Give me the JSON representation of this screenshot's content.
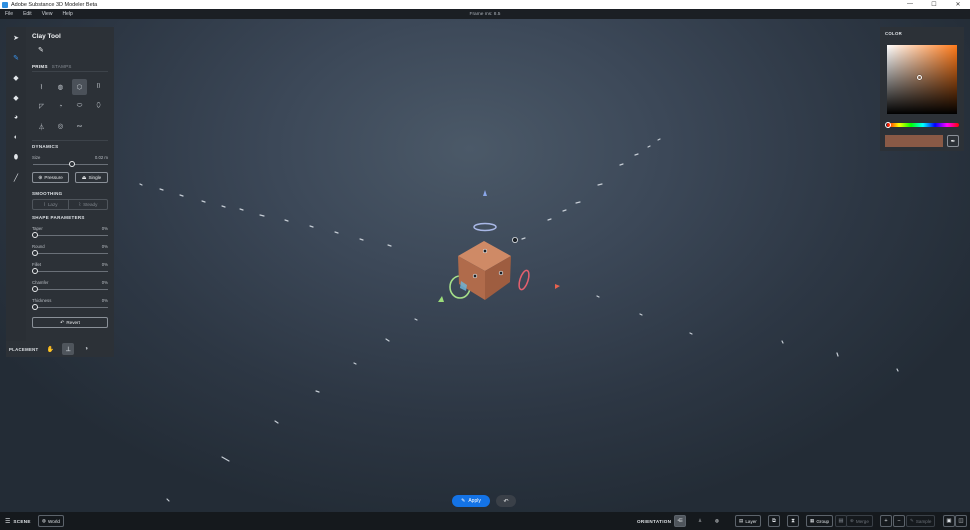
{
  "window": {
    "title": "Adobe Substance 3D Modeler Beta",
    "controls": {
      "minimize": "—",
      "maximize": "☐",
      "close": "✕"
    }
  },
  "menu": {
    "items": [
      "File",
      "Edit",
      "View",
      "Help"
    ],
    "frame_ms": "Frame ms: 8.5"
  },
  "tools": [
    {
      "icon": "select-arrow-icon",
      "glyph": "➤"
    },
    {
      "icon": "clay-brush-icon",
      "glyph": "✎"
    },
    {
      "icon": "eraser-icon",
      "glyph": "◆"
    },
    {
      "icon": "smooth-icon",
      "glyph": "◆"
    },
    {
      "icon": "scene-blob-icon",
      "glyph": "◕"
    },
    {
      "icon": "sphere-icon",
      "glyph": "◐"
    },
    {
      "icon": "paint-drop-icon",
      "glyph": "⬮"
    },
    {
      "icon": "paint-brush-icon",
      "glyph": "╱"
    }
  ],
  "clay_panel": {
    "title": "Clay Tool",
    "tabs": [
      "PRIMS",
      "STAMPS"
    ],
    "dynamics": {
      "title": "DYNAMICS",
      "size_label": "Size",
      "size_value": "0.02 m",
      "size_level": 0.55,
      "pressure_label": "Pressure",
      "single_label": "Single"
    },
    "smoothing": {
      "title": "SMOOTHING",
      "lazy_label": "Lazy",
      "steady_label": "Steady"
    },
    "shape_parameters": {
      "title": "SHAPE PARAMETERS",
      "params": [
        {
          "label": "Taper",
          "value": "0%"
        },
        {
          "label": "Round",
          "value": "0%"
        },
        {
          "label": "Fillet",
          "value": "0%"
        },
        {
          "label": "Chamfer",
          "value": "0%"
        },
        {
          "label": "Thickness",
          "value": "0%"
        }
      ]
    },
    "revert_label": "Revert"
  },
  "placement": {
    "label": "PLACEMENT"
  },
  "color_panel": {
    "title": "COLOR",
    "hue_hex": "#ff7a1a",
    "swatch_hex": "#8a5a46"
  },
  "viewport": {
    "apply_label": "Apply",
    "cube_color": "#b8714e"
  },
  "statusbar": {
    "scene_label": "SCENE",
    "world_label": "World",
    "orientation_label": "ORIENTATION",
    "layer_label": "Layer",
    "group_label": "Group",
    "merge_label": "Merge",
    "sample_label": "Sample"
  }
}
